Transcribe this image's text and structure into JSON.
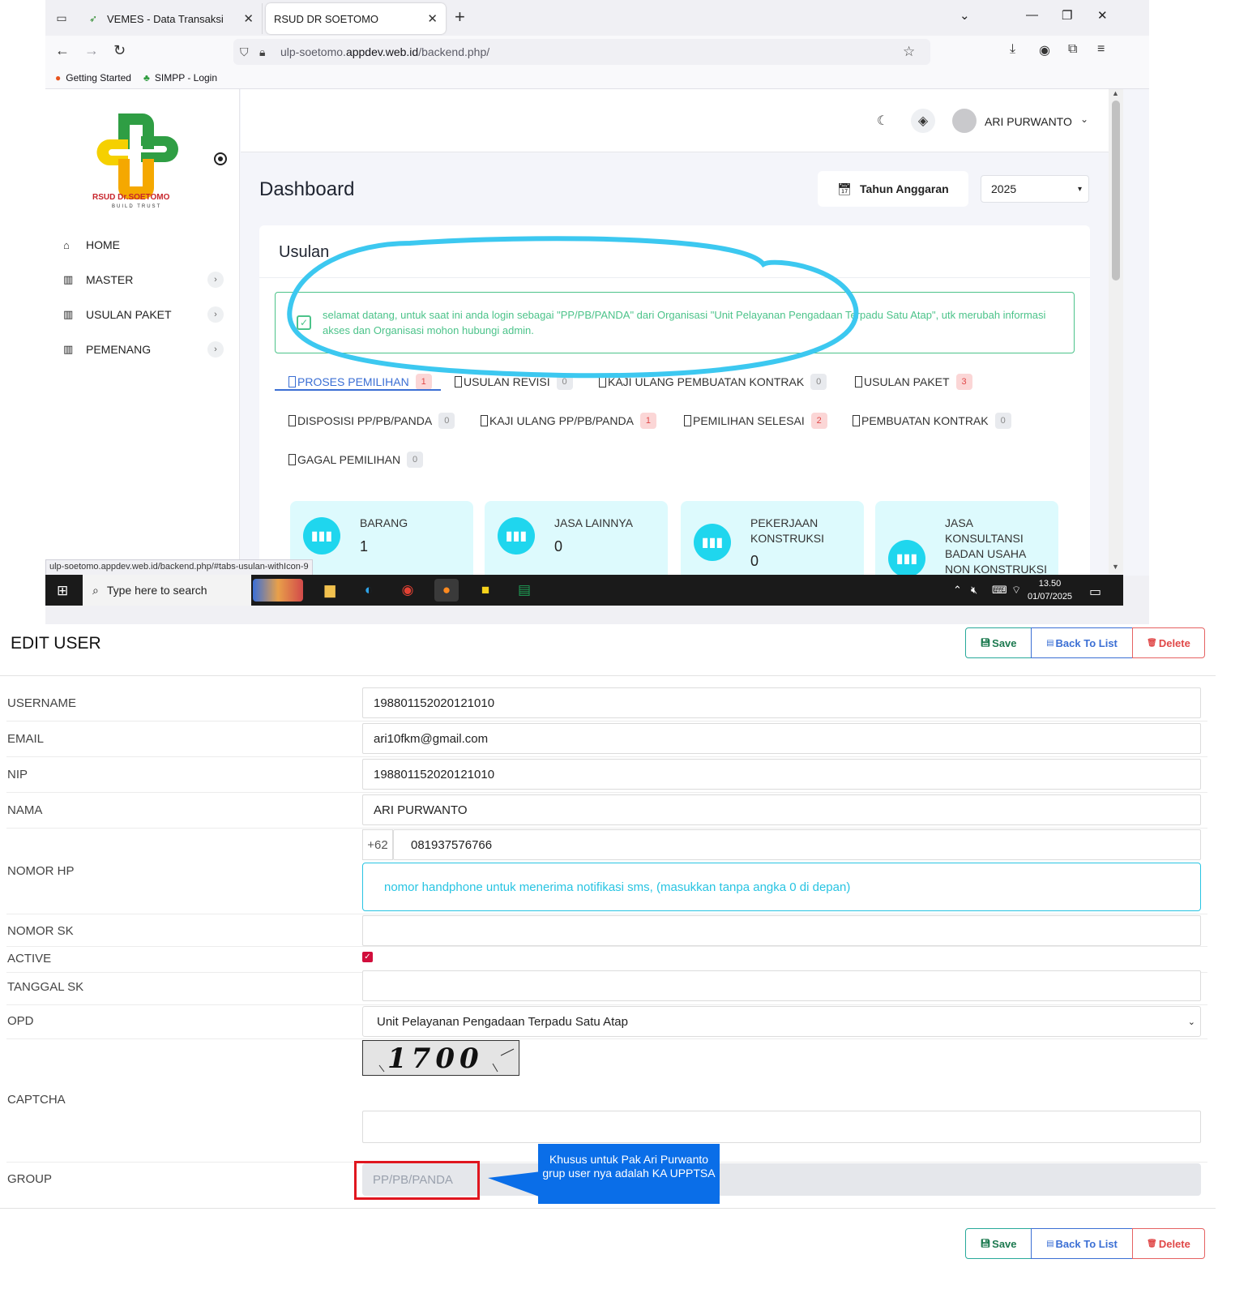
{
  "browser": {
    "tabs": [
      {
        "label": "VEMES - Data Transaksi",
        "active": false
      },
      {
        "label": "RSUD DR SOETOMO",
        "active": true
      }
    ],
    "url_prefix": "ulp-soetomo.",
    "url_host": "appdev.web.id",
    "url_path": "/backend.php/",
    "bookmarks": [
      "Getting Started",
      "SIMPP - Login"
    ],
    "status_url": "ulp-soetomo.appdev.web.id/backend.php/#tabs-usulan-withIcon-9"
  },
  "app": {
    "logo_text": "RSUD Dr.SOETOMO",
    "logo_sub": "BUILD TRUST",
    "menu": [
      {
        "label": "HOME",
        "icon": "home-icon",
        "has_chevron": false
      },
      {
        "label": "MASTER",
        "icon": "grid-icon",
        "has_chevron": true
      },
      {
        "label": "USULAN PAKET",
        "icon": "grid-icon",
        "has_chevron": true
      },
      {
        "label": "PEMENANG",
        "icon": "grid-icon",
        "has_chevron": true
      }
    ],
    "user_name": "ARI PURWANTO",
    "page_title": "Dashboard",
    "tahun_anggaran_label": "Tahun Anggaran",
    "year": "2025",
    "card_title": "Usulan",
    "alert_message": "selamat datang, untuk saat ini anda login sebagai \"PP/PB/PANDA\" dari Organisasi \"Unit Pelayanan Pengadaan Terpadu Satu Atap\", utk merubah informasi akses dan Organisasi mohon hubungi admin.",
    "process_tabs": [
      {
        "label": "PROSES PEMILIHAN",
        "count": "1",
        "badge": "red",
        "active": true
      },
      {
        "label": "USULAN REVISI",
        "count": "0",
        "badge": "gray",
        "active": false
      },
      {
        "label": "KAJI ULANG PEMBUATAN KONTRAK",
        "count": "0",
        "badge": "gray",
        "active": false
      },
      {
        "label": "USULAN PAKET",
        "count": "3",
        "badge": "red",
        "active": false
      },
      {
        "label": "DISPOSISI PP/PB/PANDA",
        "count": "0",
        "badge": "gray",
        "active": false
      },
      {
        "label": "KAJI ULANG PP/PB/PANDA",
        "count": "1",
        "badge": "red",
        "active": false
      },
      {
        "label": "PEMILIHAN SELESAI",
        "count": "2",
        "badge": "red",
        "active": false
      },
      {
        "label": "PEMBUATAN KONTRAK",
        "count": "0",
        "badge": "gray",
        "active": false
      },
      {
        "label": "GAGAL PEMILIHAN",
        "count": "0",
        "badge": "gray",
        "active": false
      }
    ],
    "stats": [
      {
        "label": "BARANG",
        "value": "1"
      },
      {
        "label": "JASA LAINNYA",
        "value": "0"
      },
      {
        "label": "PEKERJAAN KONSTRUKSI",
        "value": "0"
      },
      {
        "label": "JASA KONSULTANSI BADAN USAHA NON KONSTRUKSI",
        "value": ""
      }
    ]
  },
  "taskbar": {
    "search_placeholder": "Type here to search",
    "time": "13.50",
    "date": "01/07/2025"
  },
  "form": {
    "title": "EDIT USER",
    "save_label": "Save",
    "back_label": "Back To List",
    "delete_label": "Delete",
    "labels": {
      "username": "USERNAME",
      "email": "EMAIL",
      "nip": "NIP",
      "nama": "NAMA",
      "nomor_hp": "NOMOR HP",
      "nomor_sk": "NOMOR SK",
      "active": "ACTIVE",
      "tanggal_sk": "TANGGAL SK",
      "opd": "OPD",
      "captcha": "CAPTCHA",
      "group": "GROUP"
    },
    "values": {
      "username": "198801152020121010",
      "email": "ari10fkm@gmail.com",
      "nip": "198801152020121010",
      "nama": "ARI PURWANTO",
      "phone_prefix": "+62",
      "nomor_hp": "081937576766",
      "nomor_sk": "",
      "active": true,
      "tanggal_sk": "",
      "opd": "Unit Pelayanan Pengadaan Terpadu Satu Atap",
      "captcha_text": "1700",
      "captcha_input": "",
      "group": "PP/PB/PANDA"
    },
    "phone_hint": "nomor handphone untuk menerima notifikasi sms, (masukkan tanpa angka 0 di depan)"
  },
  "annotation": {
    "callout_text": "Khusus untuk Pak Ari Purwanto grup user nya adalah KA UPPTSA",
    "callout_color": "#0a6ee8",
    "highlight_color": "#e0161f",
    "ellipse_color": "#3cc8f0"
  }
}
